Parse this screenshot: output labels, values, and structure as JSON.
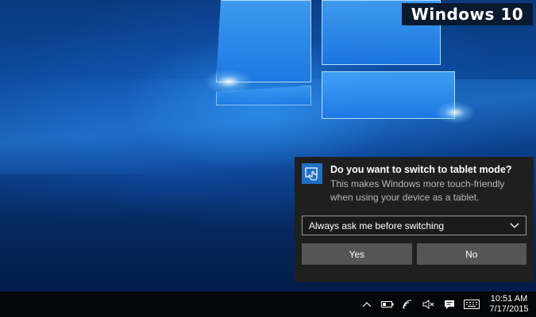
{
  "watermark": {
    "text": "Windows 10"
  },
  "notification": {
    "title": "Do you want to switch to tablet mode?",
    "body": "This makes Windows more touch-friendly when using your device as a tablet.",
    "dropdown": {
      "selected": "Always ask me before switching"
    },
    "buttons": {
      "yes": "Yes",
      "no": "No"
    }
  },
  "taskbar": {
    "tray_icons": [
      "chevron-up-icon",
      "battery-icon",
      "wifi-icon",
      "volume-muted-icon",
      "action-center-icon",
      "keyboard-icon"
    ],
    "clock": {
      "time": "10:51 AM",
      "date": "7/17/2015"
    }
  },
  "colors": {
    "accent": "#1f6fc7",
    "toast_bg": "#1f1f1f",
    "button_bg": "#555555",
    "taskbar_bg": "#050608"
  }
}
